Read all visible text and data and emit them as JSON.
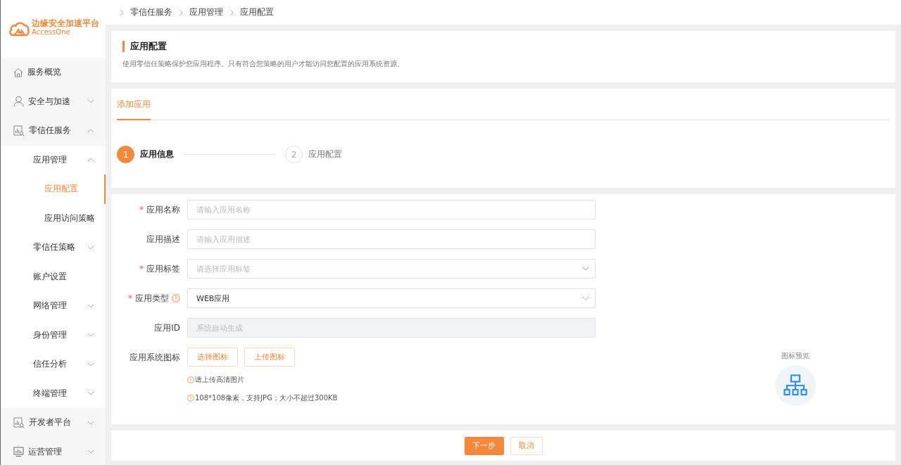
{
  "logo": {
    "title": "边缘安全加速平台",
    "subtitle": "AccessOne"
  },
  "sidebar": {
    "items": [
      {
        "label": "服务概览",
        "kind": "home",
        "expandable": false,
        "expanded": false,
        "selected": false
      },
      {
        "label": "安全与加速",
        "kind": "user",
        "expandable": true,
        "expanded": false,
        "selected": false
      },
      {
        "label": "零信任服务",
        "kind": "chart",
        "expandable": true,
        "expanded": true,
        "selected": false,
        "children": [
          {
            "label": "应用管理",
            "expandable": true,
            "expanded": true,
            "selected": false,
            "children": [
              {
                "label": "应用配置",
                "expandable": false,
                "expanded": false,
                "selected": true
              },
              {
                "label": "应用访问策略",
                "expandable": false,
                "expanded": false,
                "selected": false
              }
            ]
          },
          {
            "label": "零信任策略",
            "expandable": true,
            "expanded": false,
            "selected": false
          },
          {
            "label": "账户设置",
            "expandable": false,
            "expanded": false,
            "selected": false
          },
          {
            "label": "网络管理",
            "expandable": true,
            "expanded": false,
            "selected": false
          },
          {
            "label": "身份管理",
            "expandable": true,
            "expanded": false,
            "selected": false
          },
          {
            "label": "信任分析",
            "expandable": true,
            "expanded": false,
            "selected": false
          },
          {
            "label": "终端管理",
            "expandable": true,
            "expanded": false,
            "selected": false
          }
        ]
      },
      {
        "label": "开发者平台",
        "kind": "chart",
        "expandable": true,
        "expanded": false,
        "selected": false
      },
      {
        "label": "运营管理",
        "kind": "monitor",
        "expandable": true,
        "expanded": false,
        "selected": false
      }
    ]
  },
  "breadcrumb": [
    "零信任服务",
    "应用管理",
    "应用配置"
  ],
  "header": {
    "title": "应用配置",
    "description": "使用零信任策略保护您应用程序。只有符合您策略的用户才能访问您配置的应用系统资源。"
  },
  "tabs": [
    {
      "label": "添加应用",
      "selected": true
    }
  ],
  "steps": [
    {
      "number": "1",
      "label": "应用信息",
      "selected": true
    },
    {
      "number": "2",
      "label": "应用配置",
      "selected": false
    }
  ],
  "form": {
    "fields": [
      {
        "label": "应用名称",
        "required_mark": "*",
        "info": false,
        "kind": "input",
        "placeholder": "请输入应用名称"
      },
      {
        "label": "应用描述",
        "info": false,
        "kind": "input",
        "placeholder": "请输入应用描述"
      },
      {
        "label": "应用标签",
        "required_mark": "*",
        "info": false,
        "kind": "select",
        "placeholder": "请选择应用标签"
      },
      {
        "label": "应用类型",
        "required_mark": "*",
        "info": true,
        "kind": "select",
        "value": "WEB应用"
      },
      {
        "label": "应用ID",
        "info": false,
        "kind": "disabled",
        "placeholder": "系统自动生成"
      }
    ],
    "icon_field": {
      "label": "应用系统图标",
      "buttons": [
        "选择图标",
        "上传图标"
      ],
      "hints": [
        "请上传高清图片",
        "108*108像素，支持JPG；大小不超过300KB"
      ]
    },
    "preview": {
      "label": "图标预览"
    }
  },
  "footer": {
    "buttons": [
      {
        "label": "下一步",
        "kind": "primary"
      },
      {
        "label": "取消",
        "kind": "secondary"
      }
    ]
  }
}
